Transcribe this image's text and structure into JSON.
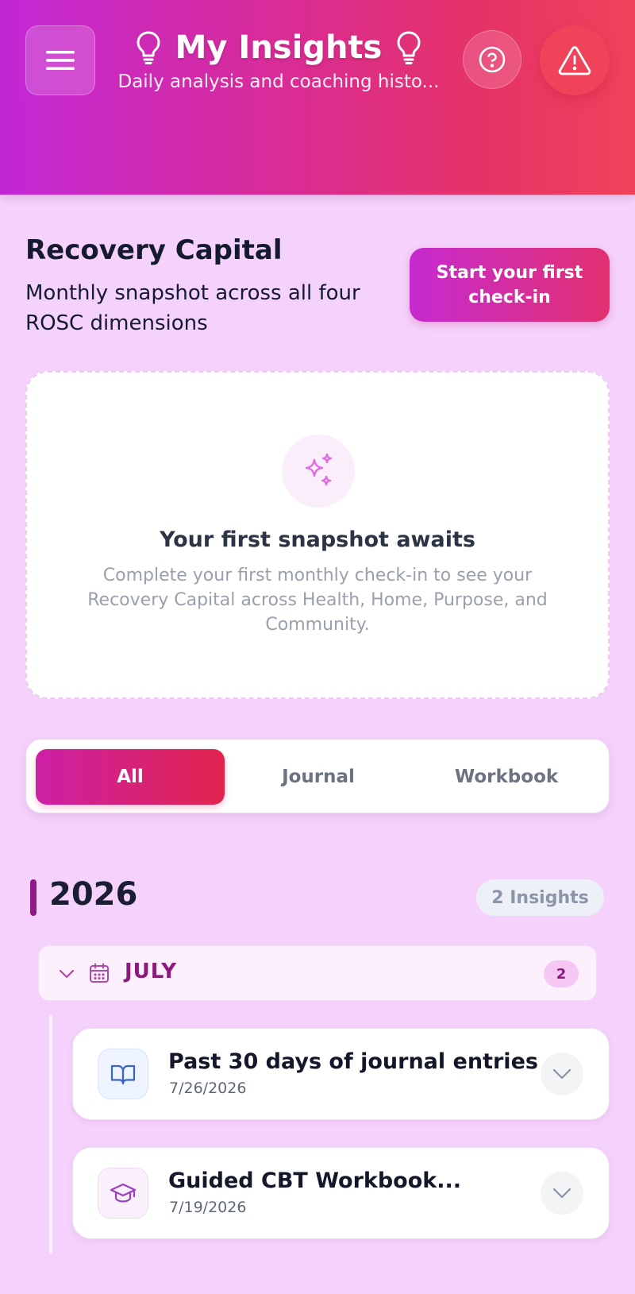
{
  "header": {
    "title": "My Insights",
    "subtitle": "Daily analysis and coaching histo...",
    "icons": {
      "menu": "menu-icon",
      "title_left": "lightbulb-icon",
      "title_right": "lightbulb-icon",
      "help": "help-circle-icon",
      "alert": "warning-triangle-icon"
    }
  },
  "recovery_capital": {
    "title": "Recovery Capital",
    "subtitle": "Monthly snapshot across all four ROSC dimensions",
    "start_button": "Start your first check-in"
  },
  "empty_snapshot": {
    "icon": "sparkles-icon",
    "title": "Your first snapshot awaits",
    "text": "Complete your first monthly check-in to see your Recovery Capital across Health, Home, Purpose, and Community."
  },
  "tabs": [
    {
      "label": "All",
      "active": true
    },
    {
      "label": "Journal",
      "active": false
    },
    {
      "label": "Workbook",
      "active": false
    }
  ],
  "year_group": {
    "year": "2026",
    "count_label": "2 Insights"
  },
  "month_group": {
    "label": "JULY",
    "count": "2",
    "icons": {
      "chevron": "chevron-down-icon",
      "calendar": "calendar-icon"
    }
  },
  "insights": [
    {
      "title": "Past 30 days of journal entries",
      "date": "7/26/2026",
      "icon": "book-open-icon"
    },
    {
      "title": "Guided CBT Workbook...",
      "date": "7/19/2026",
      "icon": "graduation-cap-icon"
    }
  ],
  "colors": {
    "background": "#f4d2fb",
    "accent_magenta": "#c227d6",
    "accent_red": "#f2425a",
    "month_text": "#8b1a7f"
  }
}
